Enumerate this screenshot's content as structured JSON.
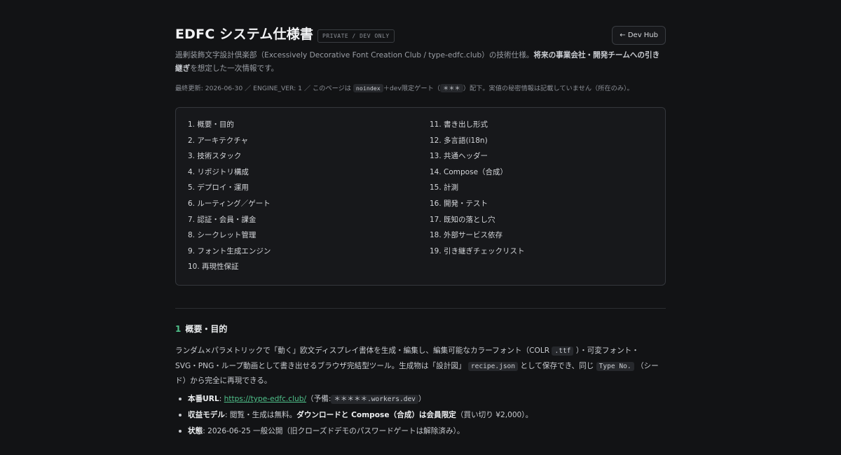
{
  "header": {
    "title": "EDFC システム仕様書",
    "badge": "PRIVATE / DEV ONLY",
    "hub_button": "← Dev Hub"
  },
  "intro": {
    "text": "過剰装飾文字設計倶楽部（Excessively Decorative Font Creation Club / type-edfc.club）の技術仕様。",
    "bold": "将来の事業会社・開発チームへの引き継ぎ",
    "text_end": "を想定した一次情報です。"
  },
  "meta": {
    "prefix": "最終更新: 2026-06-30 ／ ENGINE_VER: 1 ／ このページは",
    "code1": "noindex",
    "mid": "＋dev限定ゲート（",
    "code2": "＊＊＊",
    "suffix": "）配下。実値の秘密情報は記載していません（所在のみ）。"
  },
  "toc": {
    "left": [
      "1. 概要・目的",
      "2. アーキテクチャ",
      "3. 技術スタック",
      "4. リポジトリ構成",
      "5. デプロイ・運用",
      "6. ルーティング／ゲート",
      "7. 認証・会員・課金",
      "8. シークレット管理",
      "9. フォント生成エンジン",
      "10. 再現性保証"
    ],
    "right": [
      "11. 書き出し形式",
      "12. 多言語(i18n)",
      "13. 共通ヘッダー",
      "14. Compose（合成）",
      "15. 計測",
      "16. 開発・テスト",
      "17. 既知の落とし穴",
      "18. 外部サービス依存",
      "19. 引き継ぎチェックリスト"
    ]
  },
  "section1": {
    "number": "1",
    "title": "概要・目的",
    "p1": "ランダム×パラメトリックで「動く」欧文ディスプレイ書体を生成・編集し、編集可能なカラーフォント（COLR",
    "code_ttf": ".ttf",
    "p2": "）・可変フォント・",
    "p3": "SVG・PNG・ループ動画として書き出せるブラウザ完結型ツール。生成物は「設計図」",
    "code_recipe": "recipe.json",
    "p4": "として保存でき、同じ",
    "code_type": "Type No.",
    "p5": "（シー",
    "p6": "ド）から完全に再現できる。",
    "bullets": {
      "url_label": "本番URL",
      "url": "https://type-edfc.club/",
      "url_backup_pre": "（予備:",
      "url_backup_code": "＊＊＊＊＊.workers.dev",
      "url_backup_post": "）",
      "revenue_label": "収益モデル",
      "revenue_text": ": 閲覧・生成は無料。",
      "revenue_bold": "ダウンロードと Compose（合成）は会員限定",
      "revenue_end": "（買い切り ¥2,000）。",
      "status_label": "状態",
      "status_text": ": 2026-06-25 一般公開（旧クローズドデモのパスワードゲートは解除済み）。"
    }
  }
}
